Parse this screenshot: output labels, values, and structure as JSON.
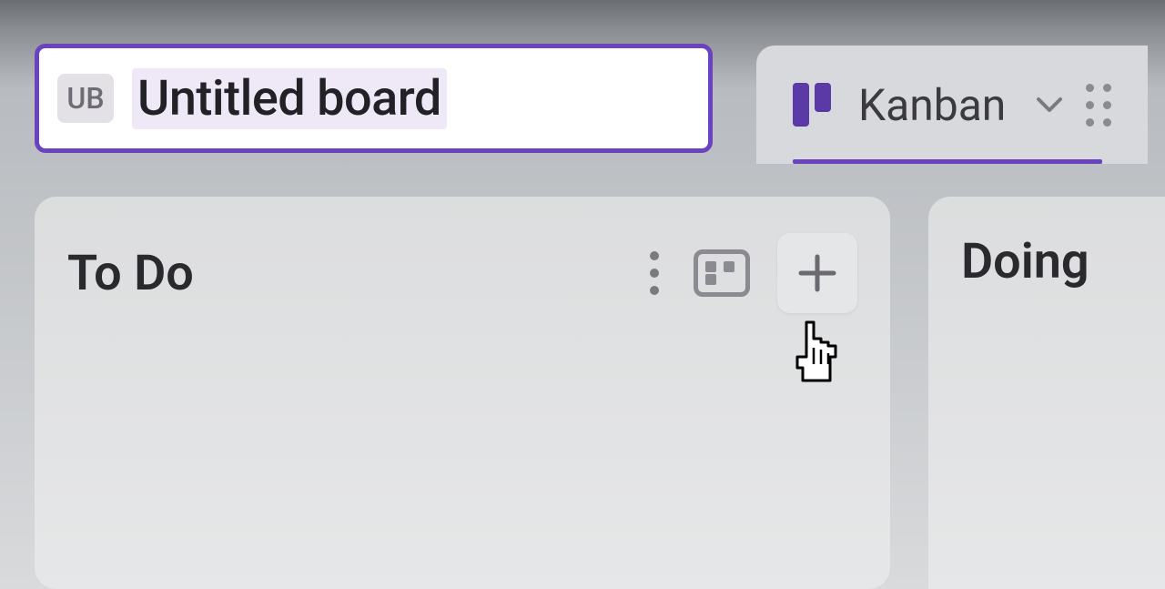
{
  "board": {
    "badge_initials": "UB",
    "title": "Untitled board"
  },
  "view": {
    "label": "Kanban"
  },
  "columns": [
    {
      "title": "To Do"
    },
    {
      "title": "Doing"
    }
  ],
  "colors": {
    "accent": "#6a43c0"
  }
}
